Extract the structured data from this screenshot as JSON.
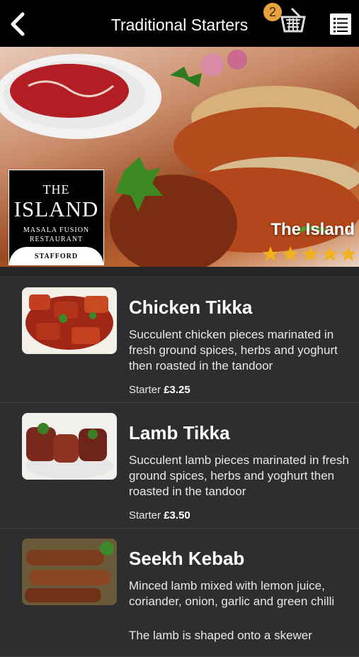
{
  "header": {
    "title": "Traditional Starters",
    "basket_count": "2"
  },
  "hero": {
    "logo": {
      "the": "THE",
      "island": "ISLAND",
      "line1": "MASALA FUSION",
      "line2": "RESTAURANT",
      "town": "STAFFORD"
    },
    "restaurant_name": "The Island",
    "rating": 5
  },
  "items": [
    {
      "name": "Chicken Tikka",
      "description": "Succulent chicken pieces marinated in fresh ground spices, herbs and yoghurt then roasted in the tandoor",
      "price_label": "Starter",
      "price": "£3.25"
    },
    {
      "name": "Lamb Tikka",
      "description": "Succulent lamb pieces marinated in fresh ground spices, herbs and yoghurt then roasted in the tandoor",
      "price_label": "Starter",
      "price": "£3.50"
    },
    {
      "name": "Seekh Kebab",
      "description": "Minced lamb mixed with lemon juice, coriander, onion, garlic and green chilli",
      "extra": "The lamb is shaped onto a skewer"
    }
  ],
  "colors": {
    "topbar": "#000000",
    "background": "#2d2d2d",
    "badge": "#e8a43c",
    "star": "#f2b21b"
  }
}
